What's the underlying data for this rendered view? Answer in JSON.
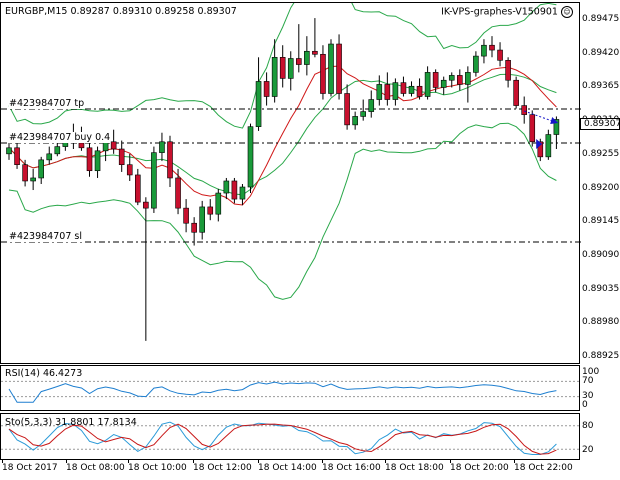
{
  "header": {
    "symbol": "EURGBP,M15",
    "open": "0.89287",
    "high": "0.89310",
    "low": "0.89258",
    "close": "0.89307",
    "expert": "IK-VPS-graphes-V150901",
    "smiley_icon": "smiley-face-icon"
  },
  "order_lines": {
    "tp_label": "#423984707 tp",
    "buy_label": "#423984707 buy 0.4",
    "sl_label": "#423984707 sl"
  },
  "price_axis": {
    "ticks": [
      "0.89475",
      "0.89420",
      "0.89365",
      "0.89310",
      "0.89255",
      "0.89200",
      "0.89145",
      "0.89090",
      "0.89035",
      "0.88980",
      "0.88925"
    ],
    "current_price": "0.89307"
  },
  "rsi": {
    "label": "RSI(14) 46.4273",
    "levels": [
      "100",
      "70",
      "30",
      "0"
    ]
  },
  "stochastic": {
    "label": "Sto(5,3,3) 31.8801 17.8134",
    "levels": [
      "80",
      "20"
    ]
  },
  "time_axis": {
    "ticks": [
      "18 Oct 2017",
      "18 Oct 08:00",
      "18 Oct 10:00",
      "18 Oct 12:00",
      "18 Oct 14:00",
      "18 Oct 16:00",
      "18 Oct 18:00",
      "18 Oct 20:00",
      "18 Oct 22:00"
    ]
  },
  "colors": {
    "bull": "#1a9a3a",
    "bear": "#c8102e",
    "band": "#2aa84a",
    "ma": "#d01818",
    "rsi_line": "#1e7fd0",
    "sto_main": "#2a9ad8",
    "sto_signal": "#c81818"
  },
  "chart_data": {
    "type": "candlestick",
    "price_range": [
      0.889,
      0.895
    ],
    "candles": [
      [
        0.8925,
        0.89268,
        0.8924,
        0.8926
      ],
      [
        0.8926,
        0.8927,
        0.89225,
        0.89232
      ],
      [
        0.89232,
        0.8924,
        0.89196,
        0.89205
      ],
      [
        0.89205,
        0.89225,
        0.8919,
        0.8921
      ],
      [
        0.8921,
        0.89245,
        0.892,
        0.8924
      ],
      [
        0.8924,
        0.89262,
        0.89232,
        0.8925
      ],
      [
        0.8925,
        0.89272,
        0.89246,
        0.89262
      ],
      [
        0.89262,
        0.89285,
        0.89255,
        0.8928
      ],
      [
        0.8928,
        0.893,
        0.89258,
        0.89268
      ],
      [
        0.89268,
        0.89295,
        0.89255,
        0.8926
      ],
      [
        0.8926,
        0.8928,
        0.89212,
        0.89222
      ],
      [
        0.89222,
        0.89262,
        0.8921,
        0.89255
      ],
      [
        0.89255,
        0.89275,
        0.89238,
        0.8927
      ],
      [
        0.8927,
        0.8929,
        0.8925,
        0.89258
      ],
      [
        0.89258,
        0.89272,
        0.8922,
        0.89232
      ],
      [
        0.89232,
        0.8925,
        0.89205,
        0.89215
      ],
      [
        0.89215,
        0.89225,
        0.89165,
        0.8917
      ],
      [
        0.8917,
        0.89178,
        0.8894,
        0.8916
      ],
      [
        0.8916,
        0.89262,
        0.89152,
        0.89252
      ],
      [
        0.89252,
        0.89285,
        0.89238,
        0.8927
      ],
      [
        0.8927,
        0.8928,
        0.89195,
        0.8921
      ],
      [
        0.8921,
        0.89225,
        0.8915,
        0.8916
      ],
      [
        0.8916,
        0.89175,
        0.8912,
        0.89135
      ],
      [
        0.89135,
        0.89145,
        0.89098,
        0.8912
      ],
      [
        0.8912,
        0.89172,
        0.89108,
        0.89162
      ],
      [
        0.89162,
        0.89175,
        0.8914,
        0.8915
      ],
      [
        0.8915,
        0.89192,
        0.89138,
        0.89185
      ],
      [
        0.89185,
        0.8921,
        0.89175,
        0.89205
      ],
      [
        0.89205,
        0.8921,
        0.89168,
        0.89175
      ],
      [
        0.89175,
        0.892,
        0.89165,
        0.89195
      ],
      [
        0.89195,
        0.893,
        0.89185,
        0.89295
      ],
      [
        0.89295,
        0.8941,
        0.89288,
        0.8937
      ],
      [
        0.8937,
        0.89385,
        0.8933,
        0.89345
      ],
      [
        0.89345,
        0.8944,
        0.89335,
        0.8941
      ],
      [
        0.8941,
        0.8943,
        0.8936,
        0.89375
      ],
      [
        0.89375,
        0.8942,
        0.89355,
        0.89408
      ],
      [
        0.89408,
        0.89465,
        0.89385,
        0.89398
      ],
      [
        0.89398,
        0.89445,
        0.8938,
        0.8942
      ],
      [
        0.8942,
        0.89475,
        0.8941,
        0.89415
      ],
      [
        0.89415,
        0.8943,
        0.8934,
        0.8935
      ],
      [
        0.8935,
        0.8944,
        0.89345,
        0.89432
      ],
      [
        0.89432,
        0.89448,
        0.8934,
        0.8935
      ],
      [
        0.8935,
        0.89365,
        0.8929,
        0.89298
      ],
      [
        0.89298,
        0.8932,
        0.8929,
        0.89312
      ],
      [
        0.89312,
        0.8934,
        0.89305,
        0.8932
      ],
      [
        0.8932,
        0.89355,
        0.8931,
        0.8934
      ],
      [
        0.8934,
        0.8938,
        0.8933,
        0.89365
      ],
      [
        0.89365,
        0.89385,
        0.8933,
        0.8934
      ],
      [
        0.8934,
        0.89375,
        0.8933,
        0.89368
      ],
      [
        0.89368,
        0.89378,
        0.89345,
        0.8935
      ],
      [
        0.8935,
        0.8937,
        0.89345,
        0.89362
      ],
      [
        0.89362,
        0.89375,
        0.8934,
        0.89345
      ],
      [
        0.89345,
        0.89395,
        0.8934,
        0.89385
      ],
      [
        0.89385,
        0.8939,
        0.89352,
        0.8936
      ],
      [
        0.8936,
        0.89378,
        0.89348,
        0.89372
      ],
      [
        0.89372,
        0.89385,
        0.8936,
        0.8938
      ],
      [
        0.8938,
        0.8939,
        0.89355,
        0.89365
      ],
      [
        0.89365,
        0.89395,
        0.89335,
        0.89385
      ],
      [
        0.89385,
        0.8942,
        0.89378,
        0.89412
      ],
      [
        0.89412,
        0.8944,
        0.894,
        0.8943
      ],
      [
        0.8943,
        0.89445,
        0.8941,
        0.89422
      ],
      [
        0.89422,
        0.89435,
        0.89395,
        0.89405
      ],
      [
        0.89405,
        0.8941,
        0.8936,
        0.89372
      ],
      [
        0.89372,
        0.89378,
        0.89325,
        0.8933
      ],
      [
        0.8933,
        0.89345,
        0.893,
        0.89315
      ],
      [
        0.89315,
        0.89322,
        0.89262,
        0.8927
      ],
      [
        0.8927,
        0.89275,
        0.89238,
        0.89245
      ],
      [
        0.89245,
        0.8929,
        0.8924,
        0.89282
      ],
      [
        0.89282,
        0.89312,
        0.89258,
        0.89307
      ]
    ]
  }
}
